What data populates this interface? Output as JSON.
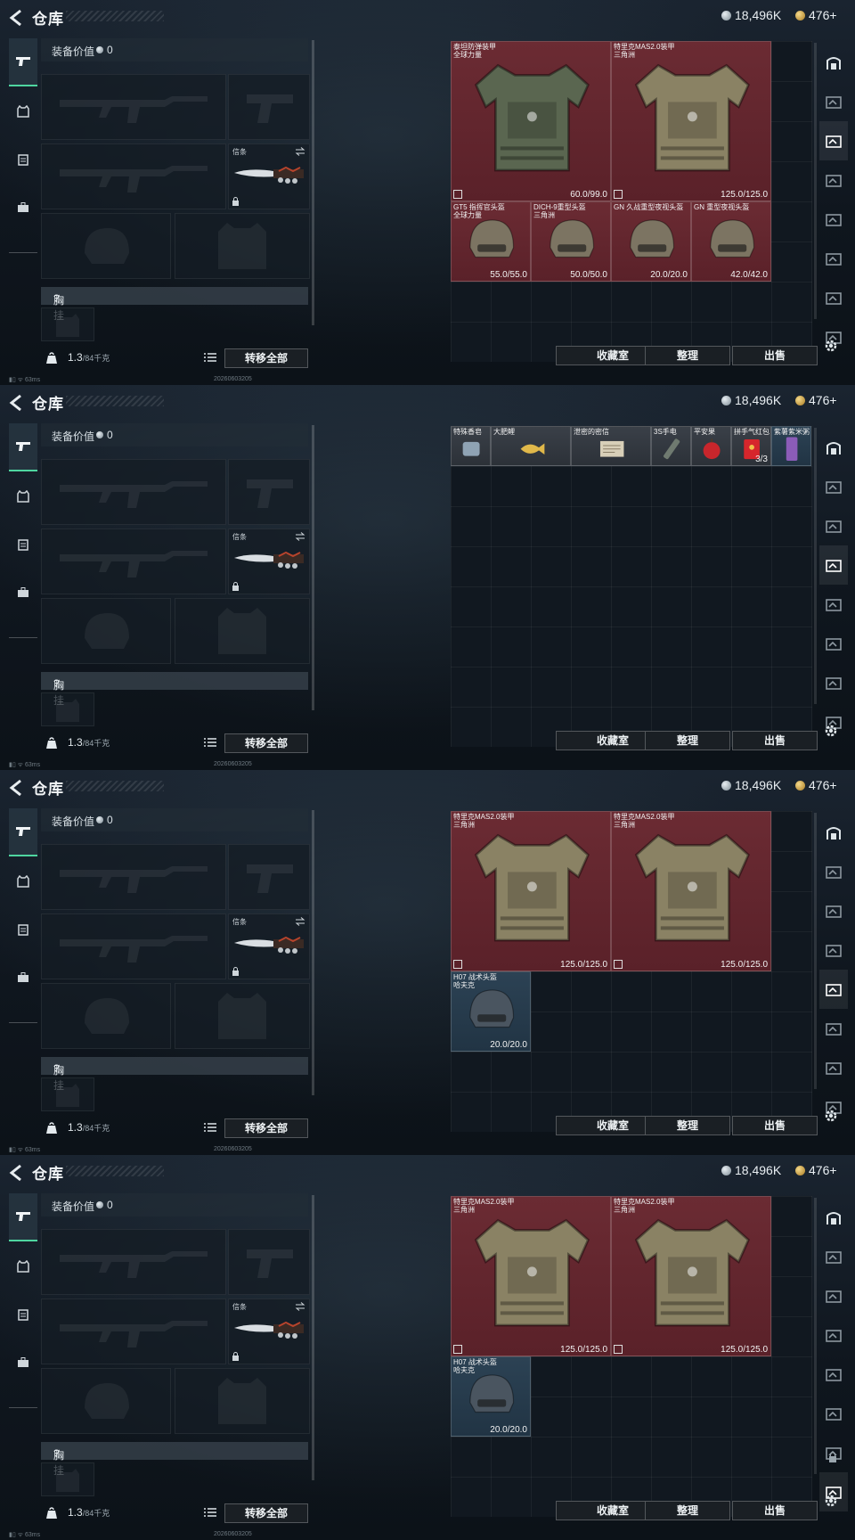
{
  "header": {
    "title": "仓库",
    "silver": "18,496K",
    "gold": "476+"
  },
  "loadout": {
    "value_label": "装备价值",
    "value": "0",
    "melee_label": "信条",
    "chest_label": "胸挂",
    "chest_hint": "?",
    "weight_value": "1.3",
    "weight_max": "/84千克",
    "transfer_all": "转移全部"
  },
  "buttons": {
    "collection": "收藏室",
    "sort": "整理",
    "sell": "出售"
  },
  "status": {
    "ping": "63ms",
    "id": "20260603205"
  },
  "panels": [
    {
      "items": [
        {
          "name": "泰坦防弹装甲",
          "sub": "全球力量",
          "durability": "60.0/99.0",
          "color": "red"
        },
        {
          "name": "特里克MAS2.0装甲",
          "sub": "三角洲",
          "durability": "125.0/125.0",
          "color": "red"
        },
        {
          "name": "GT5 指挥官头盔",
          "sub": "全球力量",
          "durability": "55.0/55.0",
          "color": "red"
        },
        {
          "name": "DICH-9重型头盔",
          "sub": "三角洲",
          "durability": "50.0/50.0",
          "color": "red"
        },
        {
          "name": "GN 久战重型夜视头盔",
          "sub": "",
          "durability": "20.0/20.0",
          "color": "red"
        },
        {
          "name": "GN 重型夜视头盔",
          "sub": "",
          "durability": "42.0/42.0",
          "color": "red"
        }
      ]
    },
    {
      "items": [
        {
          "name": "特殊香皂",
          "color": "gray"
        },
        {
          "name": "大肥鲤",
          "color": "gray"
        },
        {
          "name": "泄密的密信",
          "color": "gray"
        },
        {
          "name": "3S手电",
          "color": "gray"
        },
        {
          "name": "平安果",
          "color": "gray"
        },
        {
          "name": "拼手气红包",
          "count": "3/3",
          "color": "gray"
        },
        {
          "name": "紫薯紫米粥",
          "color": "blue"
        }
      ]
    },
    {
      "items": [
        {
          "name": "特里克MAS2.0装甲",
          "sub": "三角洲",
          "durability": "125.0/125.0",
          "color": "red"
        },
        {
          "name": "特里克MAS2.0装甲",
          "sub": "三角洲",
          "durability": "125.0/125.0",
          "color": "red"
        },
        {
          "name": "H07 战术头盔",
          "sub": "哈夫克",
          "durability": "20.0/20.0",
          "color": "blue"
        }
      ]
    },
    {
      "items": [
        {
          "name": "特里克MAS2.0装甲",
          "sub": "三角洲",
          "durability": "125.0/125.0",
          "color": "red"
        },
        {
          "name": "特里克MAS2.0装甲",
          "sub": "三角洲",
          "durability": "125.0/125.0",
          "color": "red"
        },
        {
          "name": "H07 战术头盔",
          "sub": "哈夫克",
          "durability": "20.0/20.0",
          "color": "blue"
        }
      ]
    }
  ]
}
